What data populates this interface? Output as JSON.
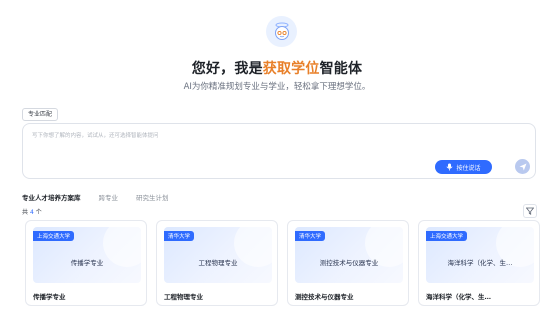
{
  "header": {
    "title_prefix": "您好，我是",
    "title_highlight": "获取学位",
    "title_suffix": "智能体",
    "subtitle": "AI为你精准规划专业与学业，轻松拿下理想学位。"
  },
  "chip": {
    "label": "专业匹配"
  },
  "input": {
    "placeholder": "写下你想了解的内容，试试从，还可选择智能体提问",
    "voice_button": "按住说话",
    "send_icon": "send-icon",
    "mic_icon": "mic-icon"
  },
  "tabs": [
    {
      "label": "专业人才培养方案库",
      "active": true
    },
    {
      "label": "跨专业",
      "active": false
    },
    {
      "label": "研究生计划",
      "active": false
    }
  ],
  "count": {
    "prefix": "共",
    "value": "4",
    "suffix": "个"
  },
  "colors": {
    "accent": "#2f6bff",
    "highlight": "#e8802a"
  },
  "cards": [
    {
      "badge": "上海交通大学",
      "thumb_title": "传播学专业",
      "name": "传播学专业"
    },
    {
      "badge": "清华大学",
      "thumb_title": "工程物理专业",
      "name": "工程物理专业"
    },
    {
      "badge": "清华大学",
      "thumb_title": "测控技术与仪器专业",
      "name": "测控技术与仪器专业"
    },
    {
      "badge": "上海交通大学",
      "thumb_title": "海洋科学（化学、生…",
      "name": "海洋科学（化学、生…"
    }
  ]
}
